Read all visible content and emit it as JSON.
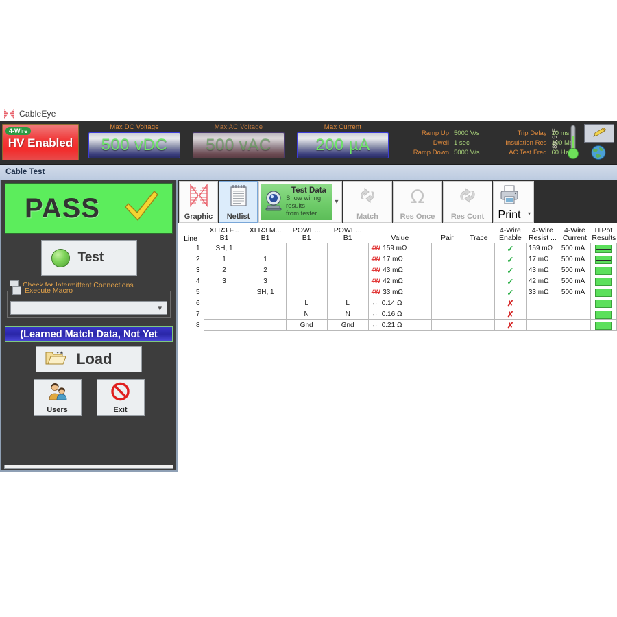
{
  "window": {
    "title": "CableEye",
    "logo_icon": "cableeye-butterfly-logo"
  },
  "statusbar": {
    "hv_badge": {
      "tag": "4-Wire",
      "label": "HV Enabled"
    },
    "meters": [
      {
        "caption": "Max DC Voltage",
        "value": "500 vDC",
        "enabled": true
      },
      {
        "caption": "Max AC Voltage",
        "value": "500 vAC",
        "enabled": false
      },
      {
        "caption": "Max Current",
        "value": "200 µA",
        "enabled": true
      }
    ],
    "params_group_1": [
      {
        "key": "Ramp Up",
        "value": "5000 V/s"
      },
      {
        "key": "Dwell",
        "value": "1 sec"
      },
      {
        "key": "Ramp Down",
        "value": "5000 V/s"
      }
    ],
    "params_group_2": [
      {
        "key": "Trip Delay",
        "value": "10 ms"
      },
      {
        "key": "Insulation Res",
        "value": "100 MΩ"
      },
      {
        "key": "AC Test Freq",
        "value": "60 Hz"
      }
    ],
    "temperature": "89.9°F",
    "thermometer_icon": "thermometer-icon",
    "edit_icon": "pencil-edit-icon",
    "globe_icon": "globe-icon"
  },
  "tabstrip": {
    "active_tab": "Cable Test"
  },
  "left_panel": {
    "result": {
      "label": "PASS",
      "check_icon": "yellow-checkmark-icon",
      "background": "#5ced5c"
    },
    "test_button": {
      "label": "Test",
      "led_icon": "green-led-icon"
    },
    "checkboxes": [
      {
        "label": "Check for Intermittent Connections",
        "checked": false
      },
      {
        "label": "Execute Macro",
        "checked": false
      }
    ],
    "macro_combo": {
      "value": "",
      "placeholder": "",
      "chevron_icon": "chevron-down-icon"
    },
    "learned_banner": "(Learned Match Data, Not Yet",
    "load_button": {
      "label": "Load",
      "icon": "open-folder-icon"
    },
    "users_button": {
      "label": "Users",
      "icon": "users-icon"
    },
    "exit_button": {
      "label": "Exit",
      "icon": "no-entry-icon"
    }
  },
  "ribbon": {
    "buttons": [
      {
        "label": "Graphic",
        "icon": "cable-graphic-icon",
        "state": "normal"
      },
      {
        "label": "Netlist",
        "icon": "notepad-icon",
        "state": "selected"
      },
      {
        "label": "Match",
        "icon": "refresh-arrows-icon",
        "state": "disabled"
      },
      {
        "label": "Res Once",
        "icon": "omega-icon",
        "state": "disabled"
      },
      {
        "label": "Res Cont",
        "icon": "cycle-arrows-icon",
        "state": "disabled"
      },
      {
        "label": "Print",
        "icon": "printer-icon",
        "state": "normal"
      }
    ],
    "test_data": {
      "title": "Test  Data",
      "subtitle_line1": "Show wiring results",
      "subtitle_line2": "from tester",
      "icon": "eye-scanner-icon",
      "chevron_icon": "chevron-down-icon"
    }
  },
  "table": {
    "columns": [
      {
        "top": "",
        "bottom": "Line"
      },
      {
        "top": "XLR3 F...",
        "bottom": "B1"
      },
      {
        "top": "XLR3 M...",
        "bottom": "B1"
      },
      {
        "top": "POWE...",
        "bottom": "B1"
      },
      {
        "top": "POWE...",
        "bottom": "B1"
      },
      {
        "top": "",
        "bottom": "Value"
      },
      {
        "top": "",
        "bottom": "Pair"
      },
      {
        "top": "",
        "bottom": "Trace"
      },
      {
        "top": "4-Wire",
        "bottom": "Enable"
      },
      {
        "top": "4-Wire",
        "bottom": "Resist ..."
      },
      {
        "top": "4-Wire",
        "bottom": "Current"
      },
      {
        "top": "HiPot",
        "bottom": "Results"
      }
    ],
    "rows": [
      {
        "line": "1",
        "c1": "SH, 1",
        "c2": "",
        "c3": "",
        "c4": "",
        "value_icon": "4W",
        "value": "159 mΩ",
        "pair": "",
        "trace": "",
        "enable": "ok",
        "resist": "159 mΩ",
        "current": "500 mA",
        "hipot": "pass"
      },
      {
        "line": "2",
        "c1": "1",
        "c2": "1",
        "c3": "",
        "c4": "",
        "value_icon": "4W",
        "value": "17 mΩ",
        "pair": "",
        "trace": "",
        "enable": "ok",
        "resist": "17 mΩ",
        "current": "500 mA",
        "hipot": "pass"
      },
      {
        "line": "3",
        "c1": "2",
        "c2": "2",
        "c3": "",
        "c4": "",
        "value_icon": "4W",
        "value": "43 mΩ",
        "pair": "",
        "trace": "",
        "enable": "ok",
        "resist": "43 mΩ",
        "current": "500 mA",
        "hipot": "pass"
      },
      {
        "line": "4",
        "c1": "3",
        "c2": "3",
        "c3": "",
        "c4": "",
        "value_icon": "4W",
        "value": "42 mΩ",
        "pair": "",
        "trace": "",
        "enable": "ok",
        "resist": "42 mΩ",
        "current": "500 mA",
        "hipot": "pass"
      },
      {
        "line": "5",
        "c1": "",
        "c2": "SH, 1",
        "c3": "",
        "c4": "",
        "value_icon": "4W",
        "value": "33 mΩ",
        "pair": "",
        "trace": "",
        "enable": "ok",
        "resist": "33 mΩ",
        "current": "500 mA",
        "hipot": "pass"
      },
      {
        "line": "6",
        "c1": "",
        "c2": "",
        "c3": "L",
        "c4": "L",
        "value_icon": "↔",
        "value": "0.14 Ω",
        "pair": "",
        "trace": "",
        "enable": "x",
        "resist": "",
        "current": "",
        "hipot": "pass"
      },
      {
        "line": "7",
        "c1": "",
        "c2": "",
        "c3": "N",
        "c4": "N",
        "value_icon": "↔",
        "value": "0.16 Ω",
        "pair": "",
        "trace": "",
        "enable": "x",
        "resist": "",
        "current": "",
        "hipot": "pass"
      },
      {
        "line": "8",
        "c1": "",
        "c2": "",
        "c3": "Gnd",
        "c4": "Gnd",
        "value_icon": "↔",
        "value": "0.21 Ω",
        "pair": "",
        "trace": "",
        "enable": "x",
        "resist": "",
        "current": "",
        "hipot": "pass"
      }
    ]
  }
}
